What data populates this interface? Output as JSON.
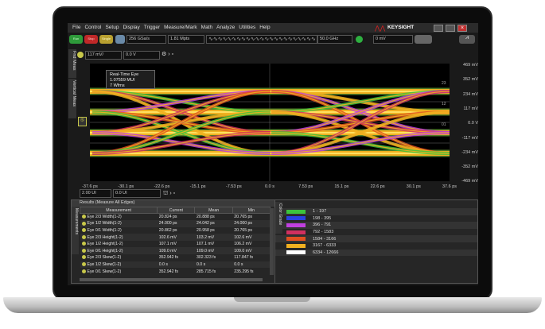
{
  "menu": [
    "File",
    "Control",
    "Setup",
    "Display",
    "Trigger",
    "Measure/Mark",
    "Math",
    "Analyze",
    "Utilities",
    "Help"
  ],
  "brand": "KEYSIGHT",
  "toolbar": {
    "run": "Run",
    "stop": "Stop",
    "single": "Single",
    "sample_rate": "256 GSa/s",
    "memory": "1.81 Mpts",
    "bandwidth": "50.0 GHz",
    "trigger_level": "0 mV"
  },
  "channel": {
    "scale": "117 mV/",
    "offset": "0.0 V"
  },
  "side_tabs": [
    "Fnd Meas",
    "Vertical Meas"
  ],
  "tooltip": {
    "title": "Real-Time Eye",
    "ui": "1.07559 MUI",
    "wfms": "7 Wfms"
  },
  "y_ticks": [
    "469 mV",
    "352 mV",
    "234 mV",
    "117 mV",
    "0.0 V",
    "-117 mV",
    "-234 mV",
    "-352 mV",
    "-469 mV"
  ],
  "x_ticks": [
    "-37.6 ps",
    "-30.1 ps",
    "-22.6 ps",
    "-15.1 ps",
    "-7.53 ps",
    "0.0 s",
    "7.53 ps",
    "15.1 ps",
    "22.6 ps",
    "30.1 ps",
    "37.6 ps"
  ],
  "level_markers": [
    "23",
    "12",
    "01"
  ],
  "horizontal": {
    "scale": "2.00 UI",
    "position": "0.0 UI"
  },
  "results": {
    "title": "Results (Measure All Edges)",
    "side_tab": "Measurements",
    "columns": [
      "Measurement",
      "Current",
      "Mean",
      "Min"
    ],
    "rows": [
      [
        "Eye 2/3 Width(1-2)",
        "20.824 ps",
        "20.888 ps",
        "20.765 ps"
      ],
      [
        "Eye 1/2 Width(1-2)",
        "24.000 ps",
        "24.042 ps",
        "24.000 ps"
      ],
      [
        "Eye 0/1 Width(1-2)",
        "20.862 ps",
        "20.958 ps",
        "20.765 ps"
      ],
      [
        "Eye 2/3 Height(1-2)",
        "102.6 mV",
        "103.2 mV",
        "102.6 mV"
      ],
      [
        "Eye 1/2 Height(1-2)",
        "107.1 mV",
        "107.1 mV",
        "106.2 mV"
      ],
      [
        "Eye 0/1 Height(1-2)",
        "109.0 mV",
        "109.0 mV",
        "109.0 mV"
      ],
      [
        "Eye 2/3 Skew(1-2)",
        "352.942 fs",
        "302.323 fs",
        "117.847 fs"
      ],
      [
        "Eye 1/2 Skew(1-2)",
        "0.0 s",
        "0.0 s",
        "0.0 s"
      ],
      [
        "Eye 0/1 Skew(1-2)",
        "352.942 fs",
        "285.715 fs",
        "235.295 fs"
      ]
    ]
  },
  "color_grade": {
    "side_tab": "Color Grade",
    "ranges": [
      {
        "label": "1 - 197",
        "color": "#3cc43c"
      },
      {
        "label": "198 - 395",
        "color": "#2a40e0"
      },
      {
        "label": "396 - 791",
        "color": "#c040e0"
      },
      {
        "label": "792 - 1583",
        "color": "#d03060"
      },
      {
        "label": "1584 - 3166",
        "color": "#e05020"
      },
      {
        "label": "3167 - 6333",
        "color": "#f0b020"
      },
      {
        "label": "6334 - 12666",
        "color": "#ffffff"
      }
    ]
  }
}
